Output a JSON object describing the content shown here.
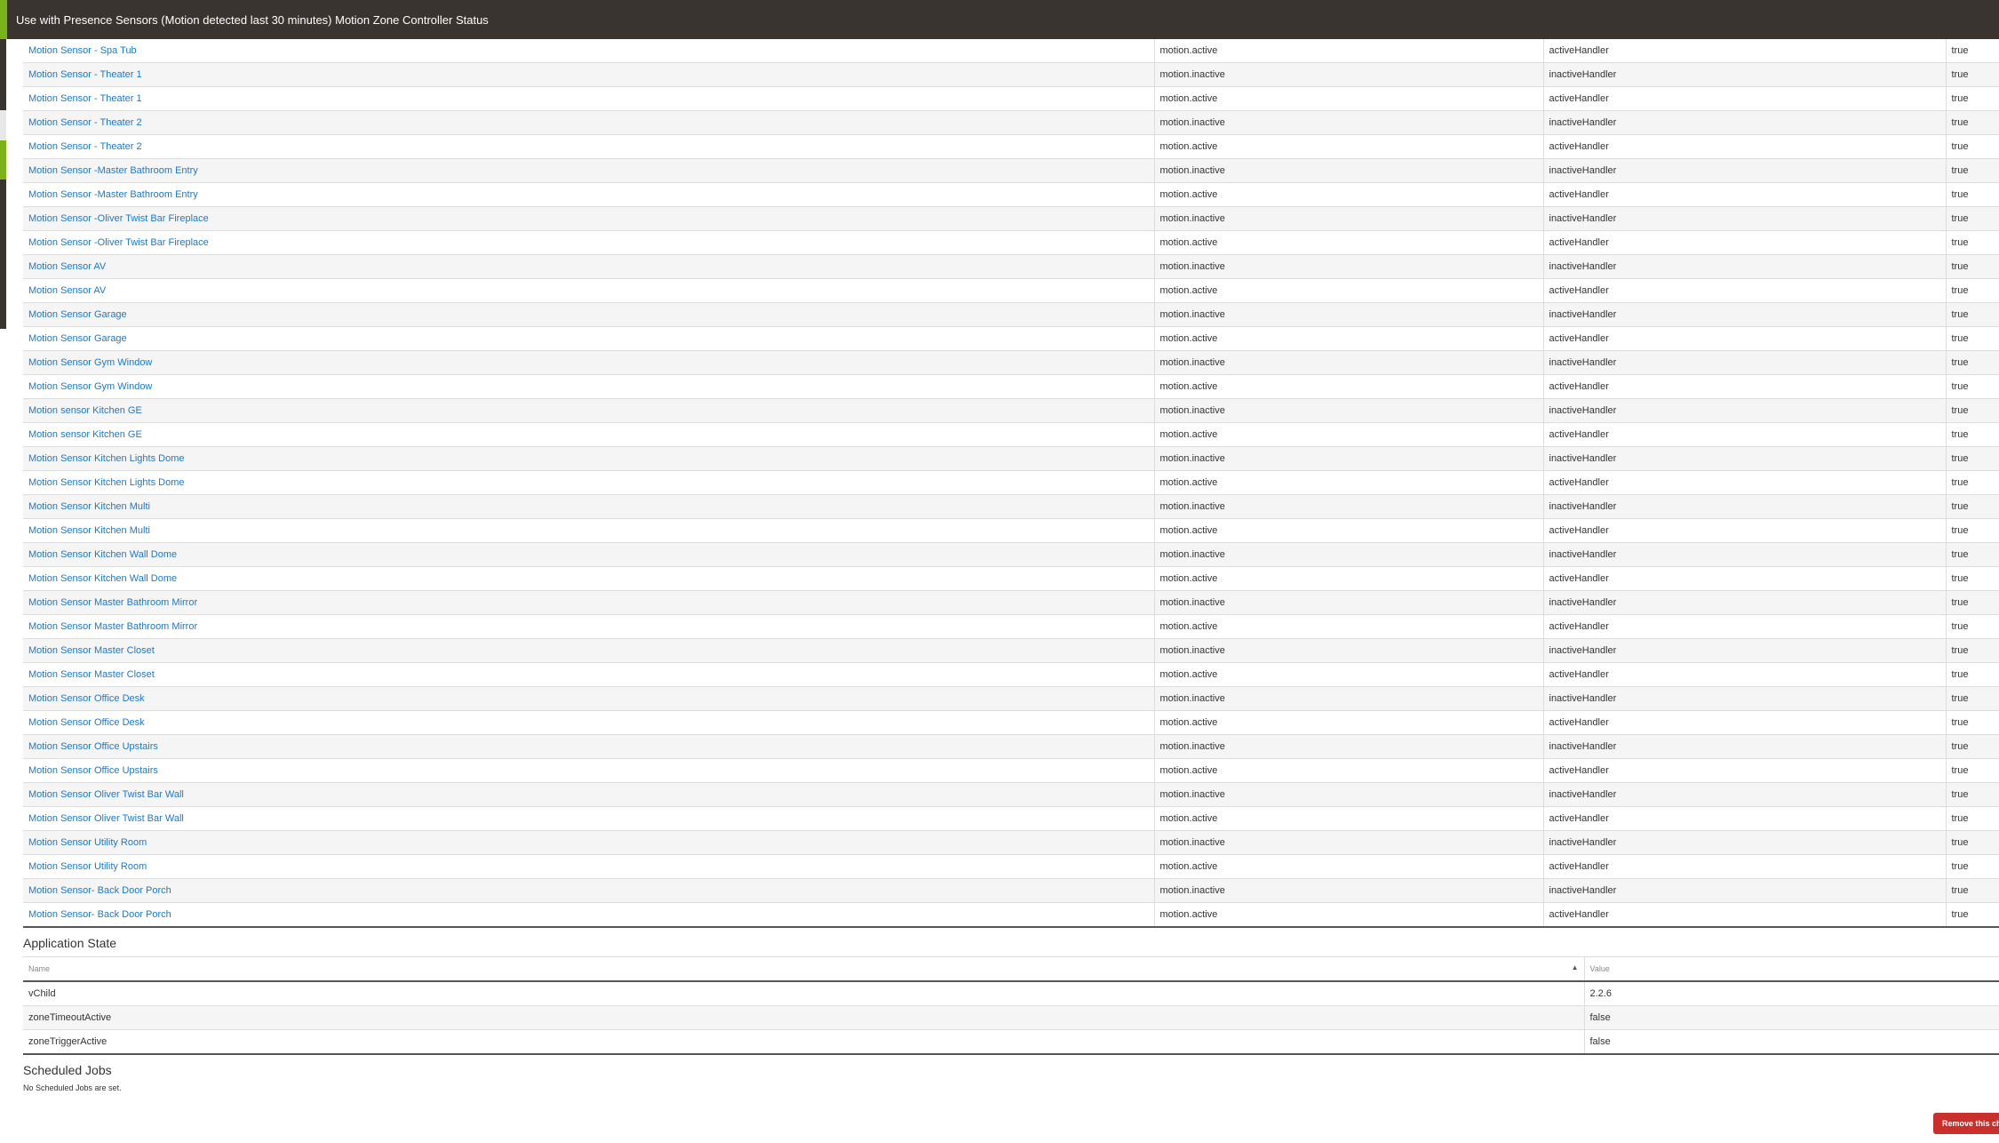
{
  "header": {
    "title": "Use with Presence Sensors (Motion detected last 30 minutes) Motion Zone Controller Status"
  },
  "subscriptions": {
    "rows": [
      {
        "device": "Motion Sensor - Spa Tub",
        "event": "motion.active",
        "handler": "activeHandler",
        "enabled": "true"
      },
      {
        "device": "Motion Sensor - Theater 1",
        "event": "motion.inactive",
        "handler": "inactiveHandler",
        "enabled": "true"
      },
      {
        "device": "Motion Sensor - Theater 1",
        "event": "motion.active",
        "handler": "activeHandler",
        "enabled": "true"
      },
      {
        "device": "Motion Sensor - Theater 2",
        "event": "motion.inactive",
        "handler": "inactiveHandler",
        "enabled": "true"
      },
      {
        "device": "Motion Sensor - Theater 2",
        "event": "motion.active",
        "handler": "activeHandler",
        "enabled": "true"
      },
      {
        "device": "Motion Sensor -Master Bathroom Entry",
        "event": "motion.inactive",
        "handler": "inactiveHandler",
        "enabled": "true"
      },
      {
        "device": "Motion Sensor -Master Bathroom Entry",
        "event": "motion.active",
        "handler": "activeHandler",
        "enabled": "true"
      },
      {
        "device": "Motion Sensor -Oliver Twist Bar Fireplace",
        "event": "motion.inactive",
        "handler": "inactiveHandler",
        "enabled": "true"
      },
      {
        "device": "Motion Sensor -Oliver Twist Bar Fireplace",
        "event": "motion.active",
        "handler": "activeHandler",
        "enabled": "true"
      },
      {
        "device": "Motion Sensor AV",
        "event": "motion.inactive",
        "handler": "inactiveHandler",
        "enabled": "true"
      },
      {
        "device": "Motion Sensor AV",
        "event": "motion.active",
        "handler": "activeHandler",
        "enabled": "true"
      },
      {
        "device": "Motion Sensor Garage",
        "event": "motion.inactive",
        "handler": "inactiveHandler",
        "enabled": "true"
      },
      {
        "device": "Motion Sensor Garage",
        "event": "motion.active",
        "handler": "activeHandler",
        "enabled": "true"
      },
      {
        "device": "Motion Sensor Gym Window",
        "event": "motion.inactive",
        "handler": "inactiveHandler",
        "enabled": "true"
      },
      {
        "device": "Motion Sensor Gym Window",
        "event": "motion.active",
        "handler": "activeHandler",
        "enabled": "true"
      },
      {
        "device": "Motion sensor Kitchen GE",
        "event": "motion.inactive",
        "handler": "inactiveHandler",
        "enabled": "true"
      },
      {
        "device": "Motion sensor Kitchen GE",
        "event": "motion.active",
        "handler": "activeHandler",
        "enabled": "true"
      },
      {
        "device": "Motion Sensor Kitchen Lights Dome",
        "event": "motion.inactive",
        "handler": "inactiveHandler",
        "enabled": "true"
      },
      {
        "device": "Motion Sensor Kitchen Lights Dome",
        "event": "motion.active",
        "handler": "activeHandler",
        "enabled": "true"
      },
      {
        "device": "Motion Sensor Kitchen Multi",
        "event": "motion.inactive",
        "handler": "inactiveHandler",
        "enabled": "true"
      },
      {
        "device": "Motion Sensor Kitchen Multi",
        "event": "motion.active",
        "handler": "activeHandler",
        "enabled": "true"
      },
      {
        "device": "Motion Sensor Kitchen Wall Dome",
        "event": "motion.inactive",
        "handler": "inactiveHandler",
        "enabled": "true"
      },
      {
        "device": "Motion Sensor Kitchen Wall Dome",
        "event": "motion.active",
        "handler": "activeHandler",
        "enabled": "true"
      },
      {
        "device": "Motion Sensor Master Bathroom Mirror",
        "event": "motion.inactive",
        "handler": "inactiveHandler",
        "enabled": "true"
      },
      {
        "device": "Motion Sensor Master Bathroom Mirror",
        "event": "motion.active",
        "handler": "activeHandler",
        "enabled": "true"
      },
      {
        "device": "Motion Sensor Master Closet",
        "event": "motion.inactive",
        "handler": "inactiveHandler",
        "enabled": "true"
      },
      {
        "device": "Motion Sensor Master Closet",
        "event": "motion.active",
        "handler": "activeHandler",
        "enabled": "true"
      },
      {
        "device": "Motion Sensor Office Desk",
        "event": "motion.inactive",
        "handler": "inactiveHandler",
        "enabled": "true"
      },
      {
        "device": "Motion Sensor Office Desk",
        "event": "motion.active",
        "handler": "activeHandler",
        "enabled": "true"
      },
      {
        "device": "Motion Sensor Office Upstairs",
        "event": "motion.inactive",
        "handler": "inactiveHandler",
        "enabled": "true"
      },
      {
        "device": "Motion Sensor Office Upstairs",
        "event": "motion.active",
        "handler": "activeHandler",
        "enabled": "true"
      },
      {
        "device": "Motion Sensor Oliver Twist Bar Wall",
        "event": "motion.inactive",
        "handler": "inactiveHandler",
        "enabled": "true"
      },
      {
        "device": "Motion Sensor Oliver Twist Bar Wall",
        "event": "motion.active",
        "handler": "activeHandler",
        "enabled": "true"
      },
      {
        "device": "Motion Sensor Utility Room",
        "event": "motion.inactive",
        "handler": "inactiveHandler",
        "enabled": "true"
      },
      {
        "device": "Motion Sensor Utility Room",
        "event": "motion.active",
        "handler": "activeHandler",
        "enabled": "true"
      },
      {
        "device": "Motion Sensor- Back Door Porch",
        "event": "motion.inactive",
        "handler": "inactiveHandler",
        "enabled": "true"
      },
      {
        "device": "Motion Sensor- Back Door Porch",
        "event": "motion.active",
        "handler": "activeHandler",
        "enabled": "true"
      }
    ]
  },
  "app_state": {
    "title": "Application State",
    "columns": {
      "name": "Name",
      "value": "Value"
    },
    "rows": [
      {
        "name": "vChild",
        "value": "2.2.6"
      },
      {
        "name": "zoneTimeoutActive",
        "value": "false"
      },
      {
        "name": "zoneTriggerActive",
        "value": "false"
      }
    ]
  },
  "scheduled_jobs": {
    "title": "Scheduled Jobs",
    "empty_text": "No Scheduled Jobs are set."
  },
  "actions": {
    "remove_label": "Remove this child"
  },
  "colors": {
    "header_bg": "#3a3431",
    "accent_green": "#7ab317",
    "link_blue": "#1e78c8",
    "danger_red": "#c9302c"
  }
}
